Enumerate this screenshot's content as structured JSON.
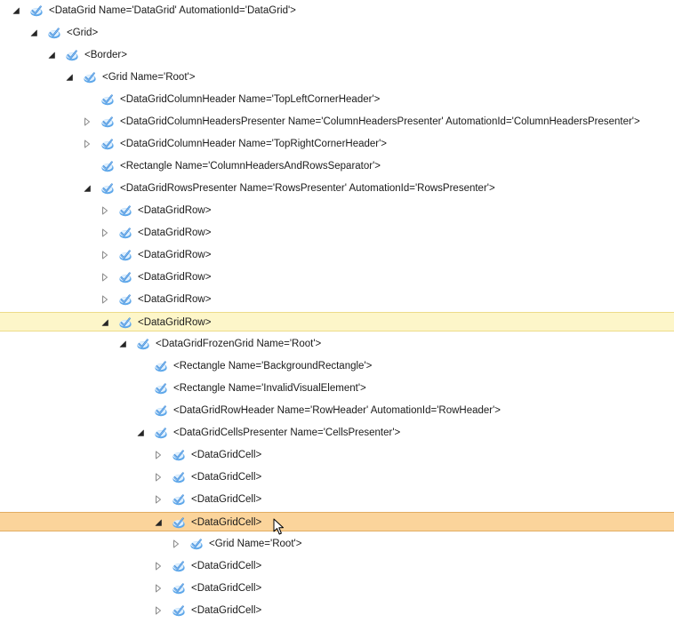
{
  "tree": {
    "nodes": [
      {
        "depth": 0,
        "state": "expanded",
        "label": "<DataGrid Name='DataGrid' AutomationId='DataGrid'>",
        "row": "normal"
      },
      {
        "depth": 1,
        "state": "expanded",
        "label": "<Grid>",
        "row": "normal"
      },
      {
        "depth": 2,
        "state": "expanded",
        "label": "<Border>",
        "row": "normal"
      },
      {
        "depth": 3,
        "state": "expanded",
        "label": "<Grid Name='Root'>",
        "row": "normal"
      },
      {
        "depth": 4,
        "state": "leaf",
        "label": "<DataGridColumnHeader Name='TopLeftCornerHeader'>",
        "row": "normal"
      },
      {
        "depth": 4,
        "state": "collapsed",
        "label": "<DataGridColumnHeadersPresenter Name='ColumnHeadersPresenter' AutomationId='ColumnHeadersPresenter'>",
        "row": "normal"
      },
      {
        "depth": 4,
        "state": "collapsed",
        "label": "<DataGridColumnHeader Name='TopRightCornerHeader'>",
        "row": "normal"
      },
      {
        "depth": 4,
        "state": "leaf",
        "label": "<Rectangle Name='ColumnHeadersAndRowsSeparator'>",
        "row": "normal"
      },
      {
        "depth": 4,
        "state": "expanded",
        "label": "<DataGridRowsPresenter Name='RowsPresenter' AutomationId='RowsPresenter'>",
        "row": "normal"
      },
      {
        "depth": 5,
        "state": "collapsed",
        "label": "<DataGridRow>",
        "row": "normal"
      },
      {
        "depth": 5,
        "state": "collapsed",
        "label": "<DataGridRow>",
        "row": "normal"
      },
      {
        "depth": 5,
        "state": "collapsed",
        "label": "<DataGridRow>",
        "row": "normal"
      },
      {
        "depth": 5,
        "state": "collapsed",
        "label": "<DataGridRow>",
        "row": "normal"
      },
      {
        "depth": 5,
        "state": "collapsed",
        "label": "<DataGridRow>",
        "row": "normal"
      },
      {
        "depth": 5,
        "state": "expanded",
        "label": "<DataGridRow>",
        "row": "highlight"
      },
      {
        "depth": 6,
        "state": "expanded",
        "label": "<DataGridFrozenGrid Name='Root'>",
        "row": "normal"
      },
      {
        "depth": 7,
        "state": "leaf",
        "label": "<Rectangle Name='BackgroundRectangle'>",
        "row": "normal"
      },
      {
        "depth": 7,
        "state": "leaf",
        "label": "<Rectangle Name='InvalidVisualElement'>",
        "row": "normal"
      },
      {
        "depth": 7,
        "state": "leaf",
        "label": "<DataGridRowHeader Name='RowHeader' AutomationId='RowHeader'>",
        "row": "normal"
      },
      {
        "depth": 7,
        "state": "expanded",
        "label": "<DataGridCellsPresenter Name='CellsPresenter'>",
        "row": "normal"
      },
      {
        "depth": 8,
        "state": "collapsed",
        "label": "<DataGridCell>",
        "row": "normal"
      },
      {
        "depth": 8,
        "state": "collapsed",
        "label": "<DataGridCell>",
        "row": "normal"
      },
      {
        "depth": 8,
        "state": "collapsed",
        "label": "<DataGridCell>",
        "row": "normal"
      },
      {
        "depth": 8,
        "state": "expanded",
        "label": "<DataGridCell>",
        "row": "selected"
      },
      {
        "depth": 9,
        "state": "collapsed",
        "label": "<Grid Name='Root'>",
        "row": "normal"
      },
      {
        "depth": 8,
        "state": "collapsed",
        "label": "<DataGridCell>",
        "row": "normal"
      },
      {
        "depth": 8,
        "state": "collapsed",
        "label": "<DataGridCell>",
        "row": "normal"
      },
      {
        "depth": 8,
        "state": "collapsed",
        "label": "<DataGridCell>",
        "row": "normal"
      }
    ]
  },
  "icons": {
    "node": "automation-element-icon",
    "expanded": "triangle-expanded-icon",
    "collapsed": "triangle-collapsed-icon",
    "cursor": "mouse-pointer-icon"
  },
  "colors": {
    "highlight_bg": "#fdf6c9",
    "selected_bg": "#fbd49b",
    "icon_blue": "#3a8ee0"
  }
}
